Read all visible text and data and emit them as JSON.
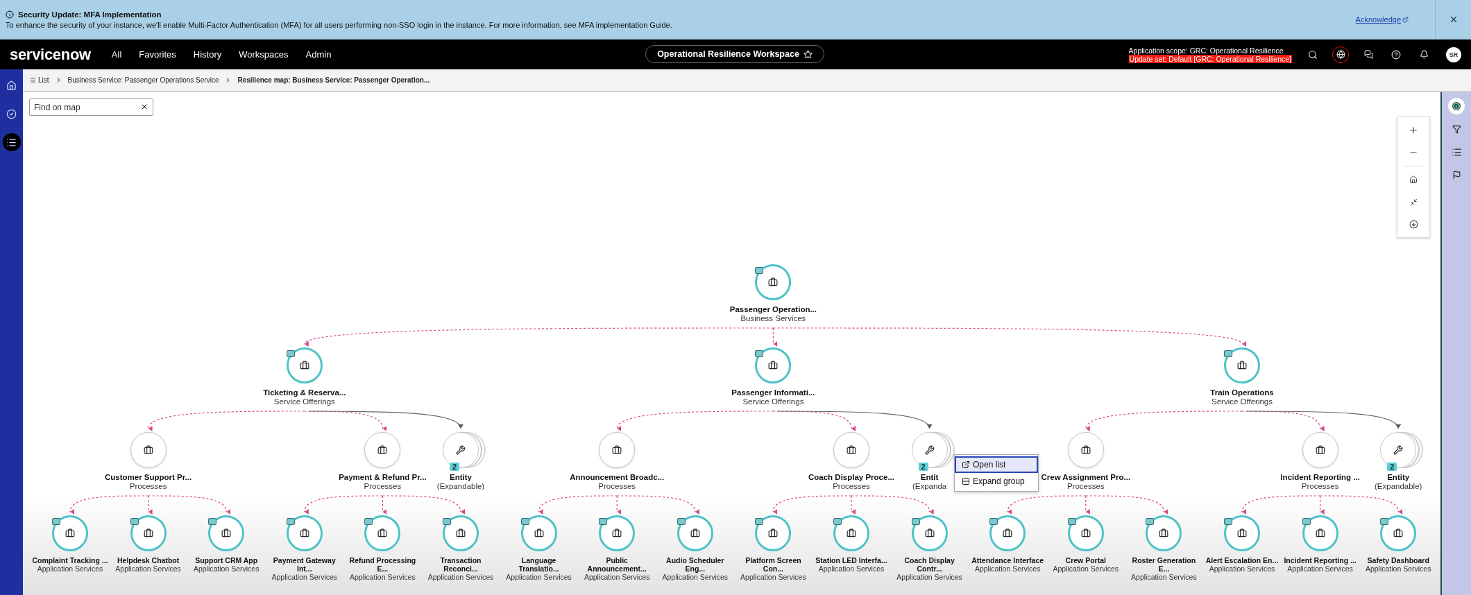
{
  "banner": {
    "title": "Security Update: MFA Implementation",
    "message": "To enhance the security of your instance, we'll enable Multi-Factor Authentication (MFA) for all users performing non-SSO login in the instance. For more information, see MFA implementation Guide.",
    "link": "Acknowledge"
  },
  "nav": {
    "logo": "servicenow",
    "menu": [
      "All",
      "Favorites",
      "History",
      "Workspaces",
      "Admin"
    ],
    "workspace": "Operational Resilience Workspace",
    "scope": "Application scope: GRC: Operational Resilience",
    "update_set": "Update set: Default [GRC: Operational Resilience]",
    "avatar": "SR"
  },
  "breadcrumbs": [
    {
      "label": "List",
      "kind": "list"
    },
    {
      "label": "Business Service: Passenger Operations Service",
      "kind": "link"
    },
    {
      "label": "Resilience map: Business Service: Passenger Operation...",
      "kind": "current"
    }
  ],
  "left_rail": [
    {
      "kind": "home",
      "selected": false
    },
    {
      "kind": "check",
      "selected": false
    },
    {
      "kind": "list",
      "selected": true
    }
  ],
  "right_rail": [
    {
      "kind": "info",
      "selected": true
    },
    {
      "kind": "filter",
      "selected": false
    },
    {
      "kind": "list",
      "selected": false
    },
    {
      "kind": "flag",
      "selected": false
    }
  ],
  "find": {
    "placeholder": "Find on map"
  },
  "map": {
    "name": "Passenger Operation...",
    "type": "Business Services",
    "kind": "service",
    "children": [
      {
        "name": "Ticketing & Reserva...",
        "type": "Service Offerings",
        "kind": "service",
        "children": [
          {
            "name": "Customer Support Pr...",
            "type": "Processes",
            "kind": "process",
            "children": [
              {
                "name": "Complaint Tracking ...",
                "type": "Application Services",
                "kind": "service"
              },
              {
                "name": "Helpdesk Chatbot",
                "type": "Application Services",
                "kind": "service"
              },
              {
                "name": "Support CRM App",
                "type": "Application Services",
                "kind": "service"
              }
            ]
          },
          {
            "name": "Payment & Refund Pr...",
            "type": "Processes",
            "kind": "process",
            "children": [
              {
                "name": "Payment Gateway Int...",
                "type": "Application Services",
                "kind": "service"
              },
              {
                "name": "Refund Processing E...",
                "type": "Application Services",
                "kind": "service"
              },
              {
                "name": "Transaction Reconci...",
                "type": "Application Services",
                "kind": "service"
              }
            ]
          },
          {
            "name": "Entity",
            "type": "(Expandable)",
            "kind": "entity",
            "badge": "2"
          }
        ]
      },
      {
        "name": "Passenger Informati...",
        "type": "Service Offerings",
        "kind": "service",
        "children": [
          {
            "name": "Announcement Broadc...",
            "type": "Processes",
            "kind": "process",
            "children": [
              {
                "name": "Language Translatio...",
                "type": "Application Services",
                "kind": "service"
              },
              {
                "name": "Public Announcement...",
                "type": "Application Services",
                "kind": "service"
              },
              {
                "name": "Audio Scheduler Eng...",
                "type": "Application Services",
                "kind": "service"
              }
            ]
          },
          {
            "name": "Coach Display Proce...",
            "type": "Processes",
            "kind": "process",
            "children": [
              {
                "name": "Platform Screen Con...",
                "type": "Application Services",
                "kind": "service"
              },
              {
                "name": "Station LED Interfa...",
                "type": "Application Services",
                "kind": "service"
              },
              {
                "name": "Coach Display Contr...",
                "type": "Application Services",
                "kind": "service"
              }
            ]
          },
          {
            "name": "Entit",
            "type": "(Expanda",
            "kind": "entity",
            "badge": "2"
          }
        ]
      },
      {
        "name": "Train Operations",
        "type": "Service Offerings",
        "kind": "service",
        "children": [
          {
            "name": "Crew Assignment Pro...",
            "type": "Processes",
            "kind": "process",
            "children": [
              {
                "name": "Attendance Interface",
                "type": "Application Services",
                "kind": "service"
              },
              {
                "name": "Crew Portal",
                "type": "Application Services",
                "kind": "service"
              },
              {
                "name": "Roster Generation E...",
                "type": "Application Services",
                "kind": "service"
              }
            ]
          },
          {
            "name": "Incident Reporting ...",
            "type": "Processes",
            "kind": "process",
            "children": [
              {
                "name": "Alert Escalation En...",
                "type": "Application Services",
                "kind": "service"
              },
              {
                "name": "Incident Reporting ...",
                "type": "Application Services",
                "kind": "service"
              },
              {
                "name": "Safety Dashboard",
                "type": "Application Services",
                "kind": "service"
              }
            ]
          },
          {
            "name": "Entity",
            "type": "(Expandable)",
            "kind": "entity",
            "badge": "2"
          }
        ]
      }
    ]
  },
  "context_menu": {
    "items": [
      {
        "label": "Open list",
        "kind": "open",
        "selected": true
      },
      {
        "label": "Expand group",
        "kind": "expand",
        "selected": false
      }
    ]
  }
}
